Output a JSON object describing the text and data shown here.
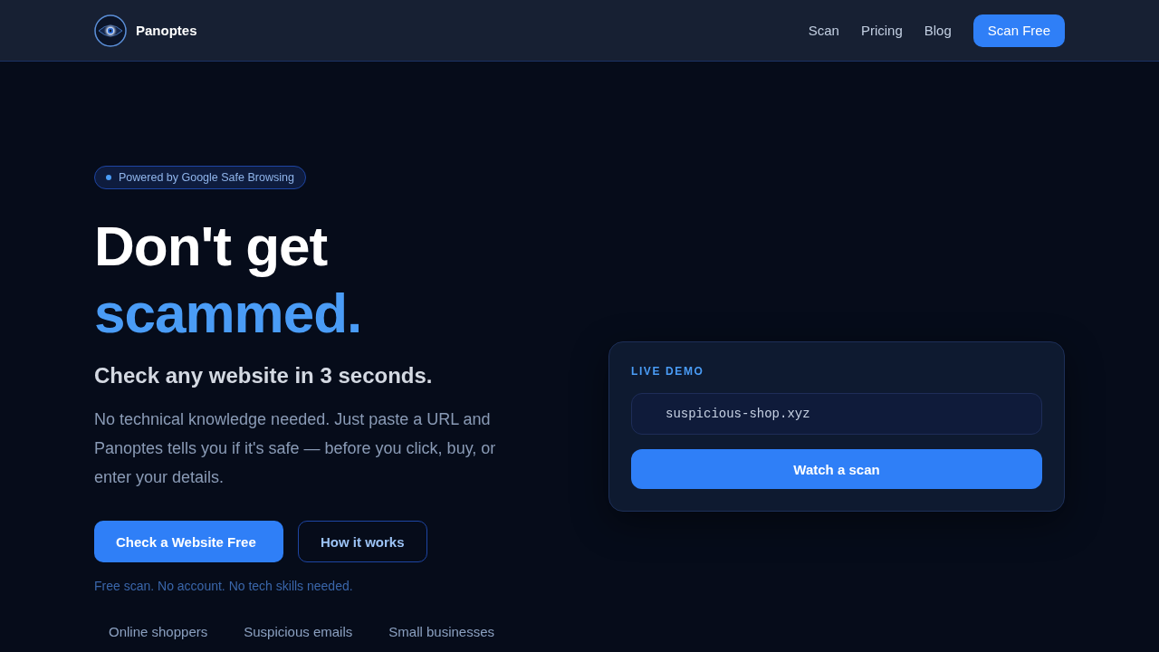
{
  "nav": {
    "brand": "Panoptes",
    "links": [
      {
        "label": "Scan"
      },
      {
        "label": "Pricing"
      },
      {
        "label": "Blog"
      }
    ],
    "cta": "Scan Free"
  },
  "hero": {
    "badge": "Powered by Google Safe Browsing",
    "headline": "Don't get",
    "headline_accent": "scammed.",
    "subheading": "Check any website in 3 seconds.",
    "description": "No technical knowledge needed. Just paste a URL and Panoptes tells you if it's safe — before you click, buy, or enter your details.",
    "buttons": [
      {
        "label": "Check a Website Free",
        "kind": "primary"
      },
      {
        "label": "How it works",
        "kind": "secondary"
      }
    ],
    "note": "Free scan. No account. No tech skills needed.",
    "audiences": [
      "Online shoppers",
      "Suspicious emails",
      "Small businesses"
    ]
  },
  "demo": {
    "label": "LIVE DEMO",
    "url": "suspicious-shop.xyz",
    "button": "Watch a scan"
  }
}
